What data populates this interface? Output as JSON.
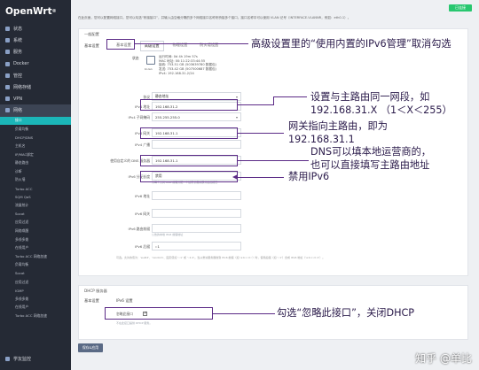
{
  "brand": "OpenWrt",
  "header_badge": "已连接",
  "nav": {
    "top_items": [
      {
        "label": "状态"
      },
      {
        "label": "系统"
      },
      {
        "label": "服务"
      },
      {
        "label": "Docker"
      },
      {
        "label": "管控"
      },
      {
        "label": "网络存储"
      },
      {
        "label": "VPN"
      },
      {
        "label": "网络"
      }
    ],
    "sub_items": [
      "接口",
      "负载均衡",
      "DHCP/DNS",
      "主机名",
      "IP/MAC绑定",
      "静态路由",
      "诊断",
      "防火墙",
      "Turbo ACC",
      "SQM QoS",
      "流量统计",
      "Socat",
      "应用过滤",
      "网络唤醒",
      "多线多拨",
      "在线用户",
      "Turbo ACC 网络加速",
      "负载均衡",
      "Socat",
      "应用过滤",
      "IGMP",
      "多线多拨",
      "在线用户",
      "Turbo ACC 网络加速"
    ],
    "bottom_item": "学友监控"
  },
  "description": "在此页面，您可以配置网络接口。您可以勾选“桥接接口”，并输入由空格分隔的多个网络接口名称来桥接多个接口。接口名称中可以使用 VLAN 记号（INTERFACE.VLANNR，例如：eth0.1）。",
  "general": {
    "title": "一般配置",
    "row_label": "基本设置",
    "tabs": [
      "基本设置",
      "高级设置",
      "物理设置",
      "防火墙设置"
    ],
    "status_label": "状态",
    "status_lines": [
      "运行时间: 0d 4h 19m 57s",
      "MAC 地址: 00:11:22:33:44:55",
      "接收: 753.51 GB (503639780 数据包)",
      "发送: 753.42 GB (507500687 数据包)",
      "IPv4: 192.168.31.2/24"
    ],
    "status_device": "br-lan",
    "fields": [
      {
        "label": "协议",
        "value": "静态地址",
        "select": true
      },
      {
        "label": "IPv4 地址",
        "value": "192.168.31.2",
        "select": false
      },
      {
        "label": "IPv4 子网掩码",
        "value": "255.255.255.0",
        "select": true
      },
      {
        "label": "IPv4 网关",
        "value": "192.168.31.1",
        "select": false
      },
      {
        "label": "IPv4 广播",
        "value": "",
        "select": false
      },
      {
        "label": "使用自定义的 DNS 服务器",
        "value": "192.168.31.1",
        "select": false
      },
      {
        "label": "IPv6 分配长度",
        "value": "禁用",
        "select": true
      },
      {
        "label": "IPv6 地址",
        "value": "",
        "select": false
      },
      {
        "label": "IPv6 网关",
        "value": "",
        "select": false
      },
      {
        "label": "IPv6 路由前缀",
        "value": "",
        "select": false
      },
      {
        "label": "IPv6 后缀",
        "value": "::1",
        "select": false
      }
    ],
    "ipv6_hint": "为每个公共 IPv6 前缀分配一个给定长度的部分给此接口",
    "prefix_hint": "公告的本地 IPv6 前缀地址",
    "suffix_hint": "可选。允许的值为：'eui64'、'random'、固定值如 '::1' 或 '::1:2'。当从委派服务器收到 IPv6 前缀（如 'a:b:c:d::'）时，使用后缀（如 '::1'）合成 IPv6 地址（'a:b:c:d::1'）。"
  },
  "dhcp": {
    "title": "DHCP 服务器",
    "row_label": "基本设置",
    "sub_label": "IPv6 设置",
    "ignore_label": "忽略此接口",
    "ignore_hint": "不在此接口提供 DHCP 服务。"
  },
  "save_button": "保存&应用",
  "annotations": {
    "adv": "高级设置里的“使用内置的IPv6管理”取消勾选",
    "ip_line1": "设置与主路由同一网段，如",
    "ip_line2": "192.168.31.X （1＜X＜255）",
    "gw_line1": "网关指向主路由，即为",
    "gw_line2": "192.168.31.1",
    "dns_line1": "DNS可以填本地运营商的，",
    "dns_line2": "也可以直接填写主路由地址",
    "ipv6": "禁用IPv6",
    "dhcp": "勾选“忽略此接口”，关闭DHCP"
  },
  "watermark": "知乎 @单比"
}
